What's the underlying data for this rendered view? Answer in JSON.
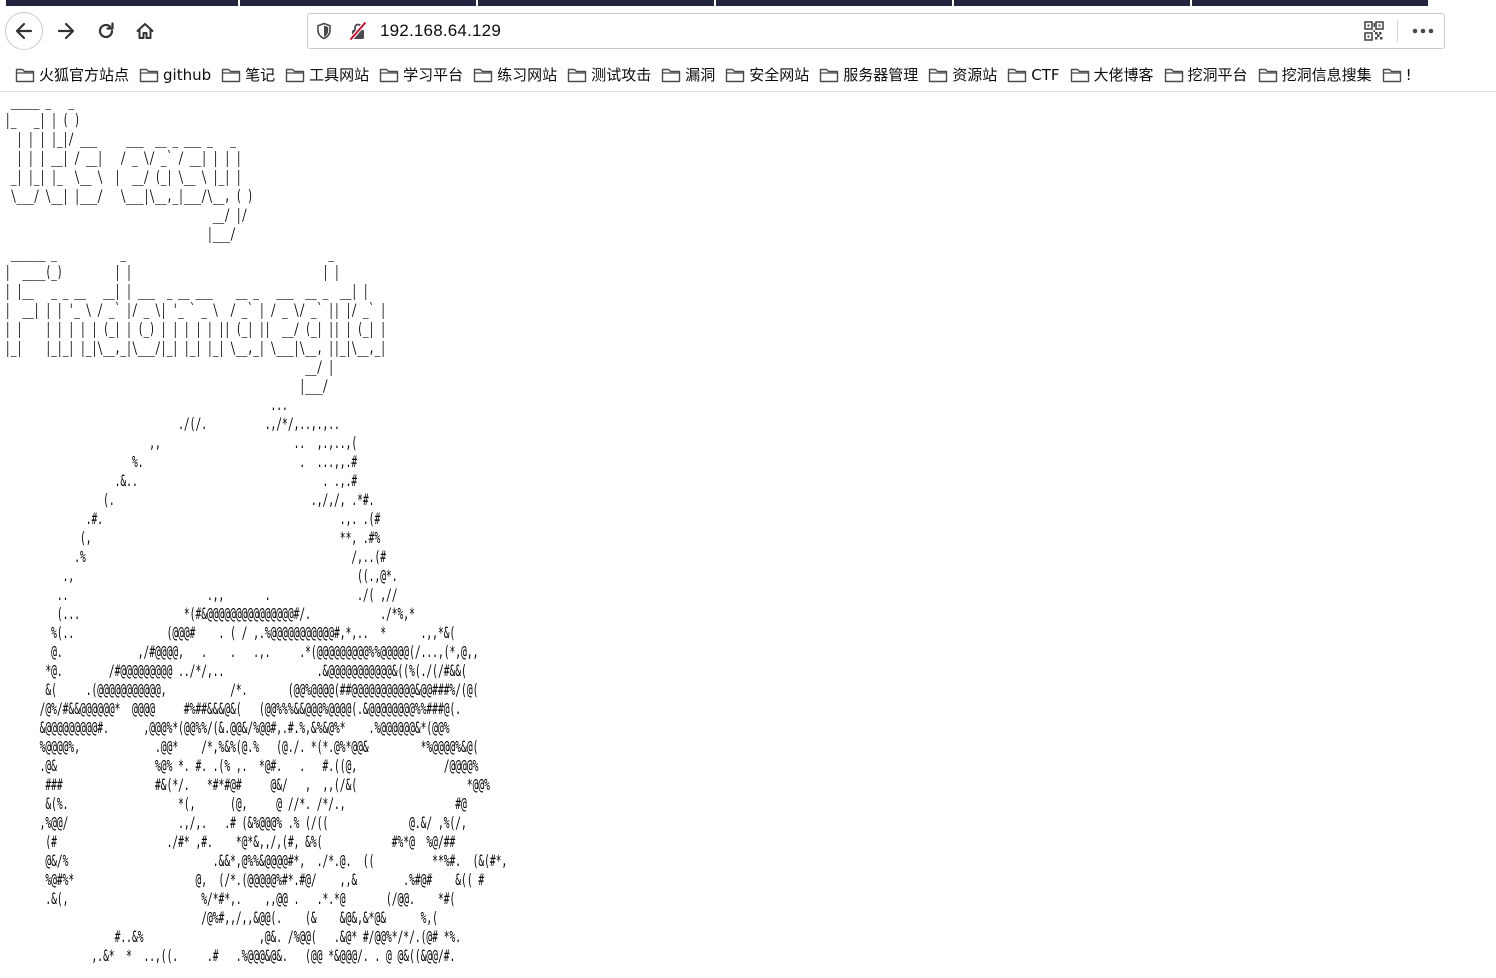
{
  "browser": {
    "url": "192.168.64.129",
    "tab_count_visible": 6
  },
  "bookmarks": [
    "火狐官方站点",
    "github",
    "笔记",
    "工具网站",
    "学习平台",
    "练习网站",
    "测试攻击",
    "漏洞",
    "安全网站",
    "服务器管理",
    "资源站",
    "CTF",
    "大佬博客",
    "挖洞平台",
    "挖洞信息搜集",
    "!"
  ],
  "page": {
    "ascii_art": " _____ _   _        \n|_   _| | ( )                                  \n  | | | |_|/ ___     ___  __ _ ___ _   _ \n  | | | __| / __|   / _ \\/ _` / __| | | |\n _| |_| |_  \\__ \\  |  __/ (_| \\__ \\ |_| |\n \\___/ \\__| |___/   \\___|\\__,_|___/\\__, ( )\n                                    __/ |/ \n                                   |___/   \n ______ _           _                                   _ \n|  ____(_)         | |                                 | |\n| |__   _ _ __   __| | ___  _ __ ___    __ _   ___  __ _  __| |\n|  __| | | '_ \\ / _` |/ _ \\| '_ ` _ \\  / _` | / _ \\/ _` || |/ _` |\n| |    | | | | | (_| | (_) | | | | | || (_| ||  __/ (_| || | (_| |\n|_|    |_|_| |_|\\__,_|\\___/|_| |_| |_| \\__,_| \\___|\\__, ||_|\\__,_|\n                                                    __/ |          \n                                                   |___/           \n                                              ...\n                              ./(/.          .,/*/,..,.,..\n                         ,,                       ..  ,.,..,(\n                      %.                           .  ...,,.#\n                   .&..                                . .,.#\n                 (.                                  .,/,/, .*#.\n              .#.                                         .,. .(#\n             (,                                           **, .#%\n            .%                                              /,..(#\n          .,                                                 ((.,@*.\n         ..                        .,,       .               ./( ,//\n         (...                  *(#&@@@@@@@@@@@@@@@#/.            ./*%,*\n        %(..                (@@@#    . ( / ,.%@@@@@@@@@@@#,*,..  *      .,,*&(\n        @.             ,/#@@@@,   .    .   .,.     .*(@@@@@@@@@%%@@@@@(/...,(*,@,,\n       *@.        /#@@@@@@@@@ ../*/,..                .&@@@@@@@@@@@&((%(./(/#&&(\n       &(     .(@@@@@@@@@@@,           /*.       (@@%@@@@(##@@@@@@@@@@@&@@###%/(@(\n      /@%/#&&@@@@@@*  @@@@     #%##&&&@&(   (@@%%%&&@@@%@@@@(.&@@@@@@@@%%###@(.\n      &@@@@@@@@@#.      ,@@@%*(@@%%/(&.@@&/%@@#,.#.%,&%&@%*    .%@@@@@@&*(@@%\n      %@@@@%,             .@@*    /*,%&%(@.%   (@./. *(*.@%*@@&         *%@@@@%&@(\n      .@&                 %@% *. #. .(% ,.  *@#.   .   #.((@,               /@@@@%\n       ###                #&(*/.   *#*#@#     @&/   ,  ,,(/&(                   *@@%\n       &(%.                   *(,      (@,     @ //*. /*/.,                   #@\n      ,%@@/                   .,/,.   .# (&%@@@% .% (/((              @.&/ ,%(/,\n       (#                   ./#* ,#.    *@*&,,/,(#, &%(            #%*@  %@/##\n       @&/%                         .&&*,@%%&@@@@#*,  ./*.@.  ((          **%#.  (&(#*,\n       %@#%*                     @,  (/*.(@@@@@%#*.#@/    ,,&        .%#@#    &(( #\n       .&(,                       %/*#*,.    ,,@@ .   .*.*@       (/@@.    *#(\n                                  /@%#,,/,,&@@(.    (&    &@&,&*@&      %,(\n                   #..&%                    ,@&. /%@@(   .&@* #/@@%*/*/.(@# *%.\n               ,.&*  *  ..,((.     .#   .%@@@&@&.   (@@ *&@@@/. . @ @&((&@@/#."
  }
}
